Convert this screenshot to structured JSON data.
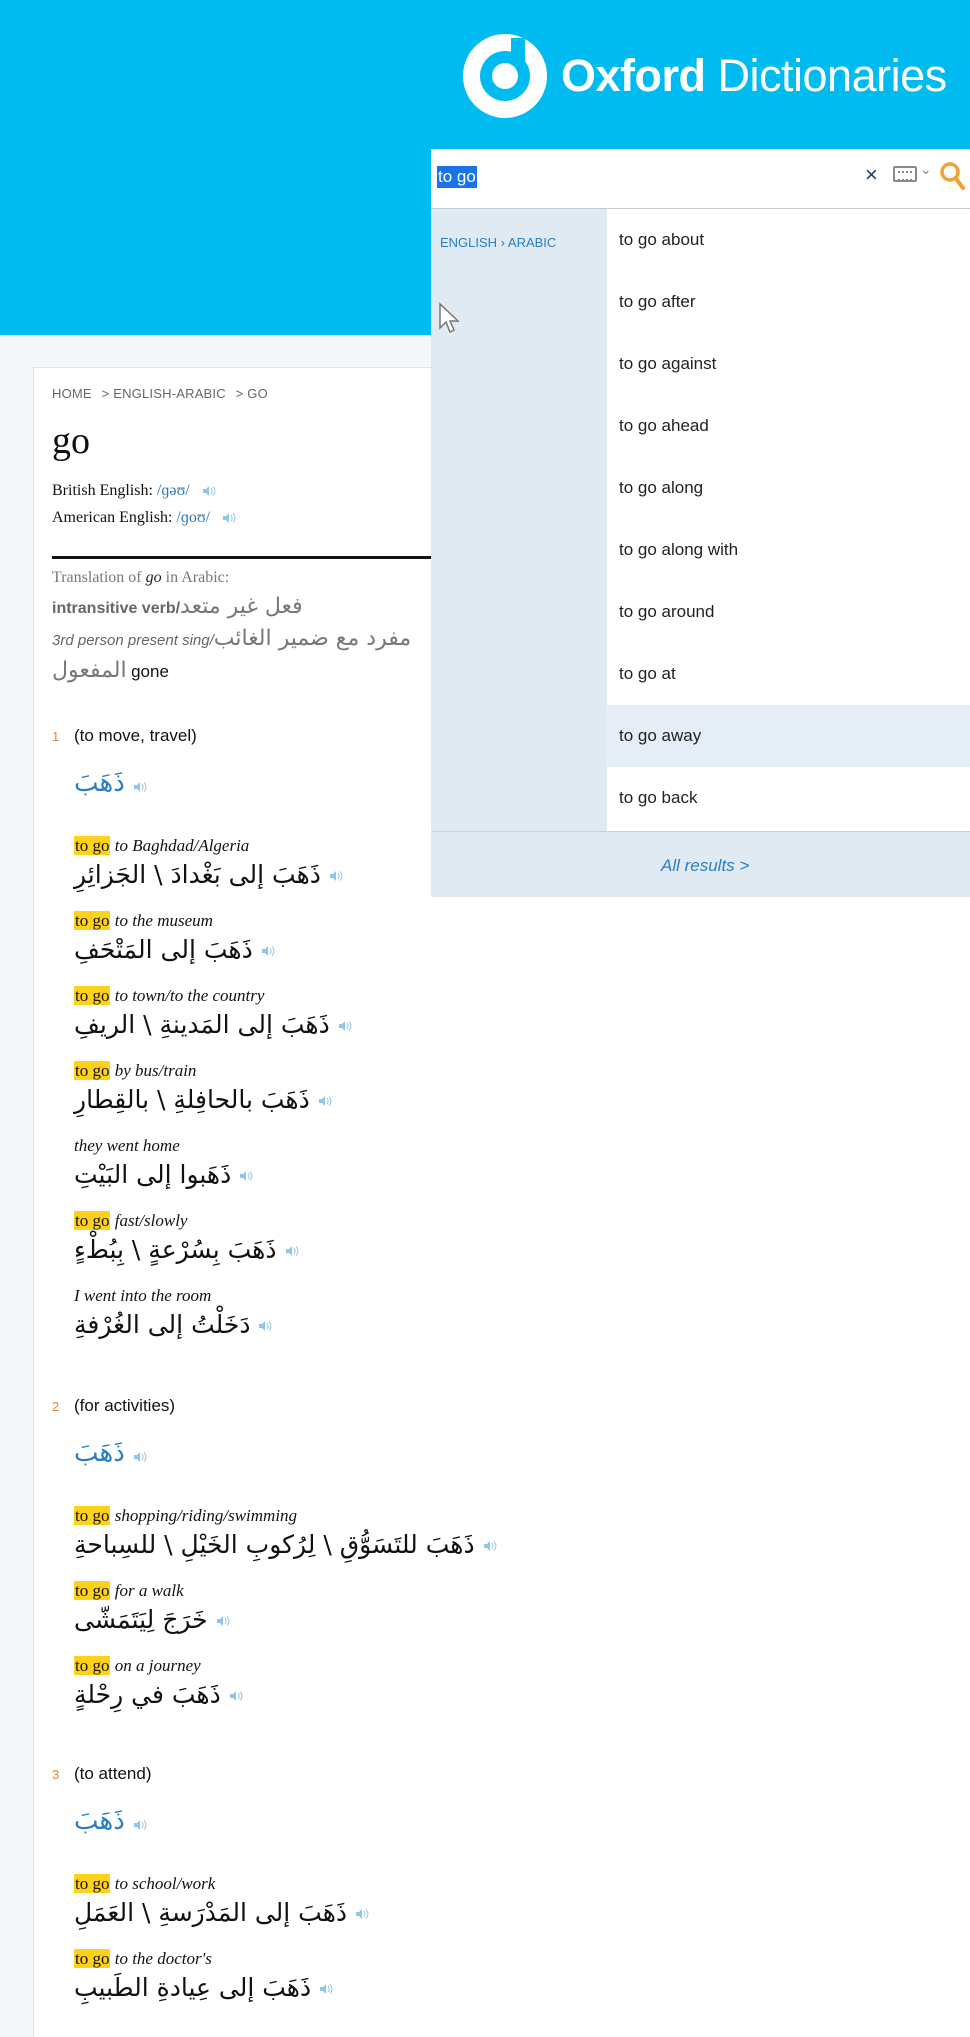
{
  "header": {
    "logo_bold": "Oxford",
    "logo_light": "Dictionaries"
  },
  "breadcrumb": [
    "HOME",
    "> ENGLISH-ARABIC",
    "> GO"
  ],
  "headword": "go",
  "pronunciations": [
    {
      "label": "British English: ",
      "ipa": "/ɡəʊ/"
    },
    {
      "label": "American English: ",
      "ipa": "/ɡoʊ/"
    }
  ],
  "translation_of": {
    "prefix": "Translation of ",
    "word": "go",
    "suffix": " in Arabic:"
  },
  "grammar": {
    "line1_label": "intransitive verb/",
    "line1_ar": "فعل غير متعد",
    "line2_label": "3rd person present sing/",
    "line2_ar": "مفرد مع ضمير الغائب",
    "line3_ar": "المفعول",
    "line3_en": "gone"
  },
  "senses": [
    {
      "num": "1",
      "label": "(to move, travel)",
      "ar": "ذَهَبَ",
      "examples": [
        {
          "hl": "to go",
          "en": "to Baghdad/Algeria",
          "ar": "ذَهَبَ إلى بَغْدادَ \\ الجَزائِرِ"
        },
        {
          "hl": "to go",
          "en": "to the museum",
          "ar": "ذَهَبَ إلى المَتْحَفِ"
        },
        {
          "hl": "to go",
          "en": "to town/to the country",
          "ar": "ذَهَبَ إلى المَدينةِ \\ الريفِ"
        },
        {
          "hl": "to go",
          "en": "by bus/train",
          "ar": "ذَهَبَ بالحافِلةِ \\ بالقِطارِ"
        },
        {
          "hl": "",
          "en": "they went home",
          "ar": "ذَهَبوا إلى البَيْتِ"
        },
        {
          "hl": "to go",
          "en": "fast/slowly",
          "ar": "ذَهَبَ بِسُرْعةٍ \\ بِبُطْءٍ"
        },
        {
          "hl": "",
          "en": "I went into the room",
          "ar": "دَخَلْتُ إلى الغُرْفةِ"
        }
      ]
    },
    {
      "num": "2",
      "label": "(for activities)",
      "ar": "ذَهَبَ",
      "examples": [
        {
          "hl": "to go",
          "en": "shopping/riding/swimming",
          "ar": "ذَهَبَ للتَسَوُّقِ \\ لِرُكوبِ الخَيْلِ \\ للسِباحةِ"
        },
        {
          "hl": "to go",
          "en": "for a walk",
          "ar": "خَرَجَ لِيَتَمَشّى"
        },
        {
          "hl": "to go",
          "en": "on a journey",
          "ar": "ذَهَبَ في رِحْلةٍ"
        }
      ]
    },
    {
      "num": "3",
      "label": "(to attend)",
      "ar": "ذَهَبَ",
      "examples": [
        {
          "hl": "to go",
          "en": "to school/work",
          "ar": "ذَهَبَ إلى المَدْرَسةِ \\ العَمَلِ"
        },
        {
          "hl": "to go",
          "en": "to the doctor's",
          "ar": "ذَهَبَ إلى عِيادةِ الطَبيبِ"
        }
      ]
    }
  ],
  "search": {
    "value": "to go",
    "category": "ENGLISH › ARABIC",
    "suggestions": [
      "to go about",
      "to go after",
      "to go against",
      "to go ahead",
      "to go along",
      "to go along with",
      "to go around",
      "to go at",
      "to go away",
      "to go back"
    ],
    "active_index": 8,
    "all_results": "All results >"
  },
  "colors": {
    "brand": "#00bbef",
    "highlight": "#ffd11a",
    "link": "#2a7ec3",
    "sense_number": "#e0893a"
  }
}
